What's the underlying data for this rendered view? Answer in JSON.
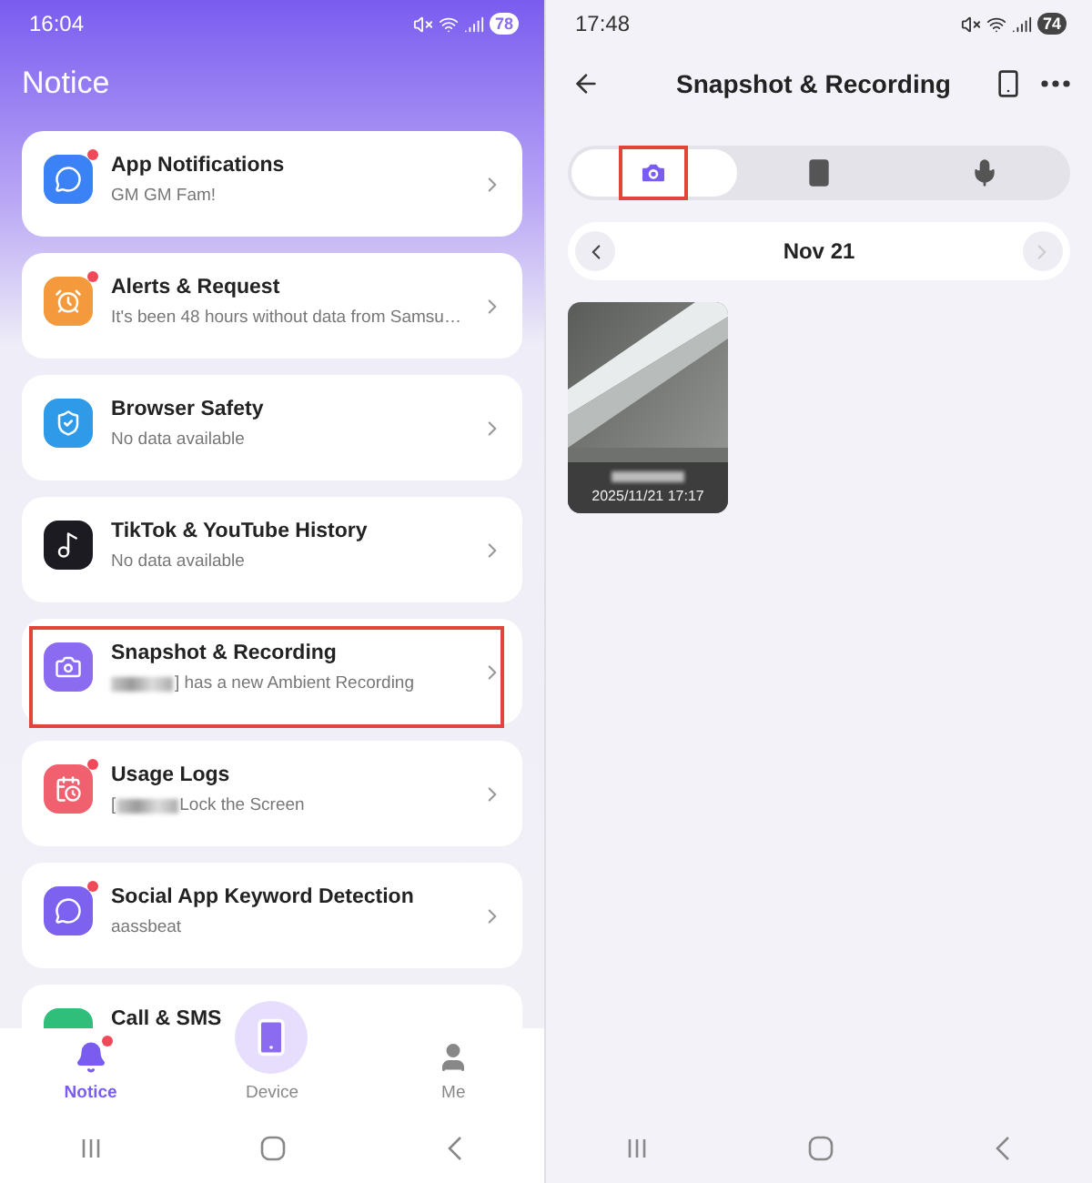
{
  "left_screen": {
    "status_bar": {
      "time": "16:04",
      "battery": "78"
    },
    "title": "Notice",
    "cards": [
      {
        "color": "#3b82f6",
        "title": "App Notifications",
        "unread": true,
        "highlighted": false,
        "subtitle": "GM GM Fam!"
      },
      {
        "color": "#f59a3c",
        "title": "Alerts & Request",
        "unread": true,
        "highlighted": false,
        "subtitle": "It's been 48 hours without data from Samsu…"
      },
      {
        "color": "#2f9be8",
        "title": "Browser Safety",
        "unread": false,
        "highlighted": false,
        "subtitle": "No data available"
      },
      {
        "color": "#1c1b22",
        "title": "TikTok & YouTube History",
        "unread": false,
        "highlighted": false,
        "subtitle": "No data available"
      },
      {
        "color": "#8b6cf0",
        "title": "Snapshot & Recording",
        "unread": false,
        "highlighted": true,
        "redacted": true,
        "subtitle": "] has a new Ambient Recording"
      },
      {
        "color": "#f0606e",
        "title": "Usage Logs",
        "unread": true,
        "highlighted": false,
        "subtitle_before": "[",
        "redacted": true,
        "subtitle": "Lock the Screen"
      },
      {
        "color": "#7c62ee",
        "title": "Social App Keyword Detection",
        "unread": true,
        "highlighted": false,
        "subtitle": "aassbeat"
      },
      {
        "color": "#2fbf7a",
        "title": "Call & SMS",
        "unread": false,
        "highlighted": false
      }
    ],
    "bottom_nav": [
      {
        "label": "Notice",
        "selected": true,
        "unread": true
      },
      {
        "label": "Device",
        "selected": false,
        "unread": false
      },
      {
        "label": "Me",
        "selected": false,
        "unread": false
      }
    ]
  },
  "right_screen": {
    "status_bar": {
      "time": "17:48",
      "battery": "74"
    },
    "title": "Snapshot & Recording",
    "tabs": [
      {
        "selected": true,
        "highlighted": true
      },
      {
        "selected": false,
        "highlighted": false
      },
      {
        "selected": false,
        "highlighted": false
      }
    ],
    "date_nav": {
      "date": "Nov 21",
      "prev_disabled": false,
      "next_disabled": true
    },
    "snapshots": [
      {
        "kind": "picture",
        "redacted": true,
        "timestamp": "2025/11/21 17:17"
      }
    ]
  }
}
